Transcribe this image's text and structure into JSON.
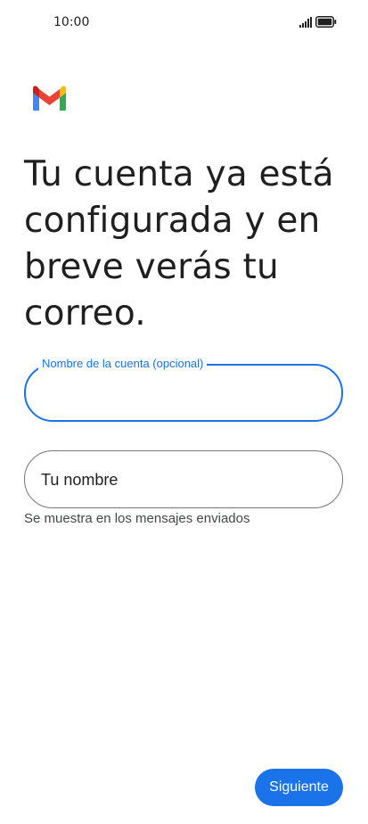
{
  "status_bar": {
    "time": "10:00",
    "icons": [
      "signal-icon",
      "battery-icon"
    ]
  },
  "logo": "gmail-logo",
  "title": "Tu cuenta ya está configurada y en breve verás tu correo.",
  "account_name_field": {
    "label": "Nombre de la cuenta (opcional)",
    "value": ""
  },
  "your_name_field": {
    "label": "Tu nombre",
    "value": "",
    "helper": "Se muestra en los mensajes enviados"
  },
  "next_button": {
    "label": "Siguiente"
  },
  "colors": {
    "accent": "#1a73e8",
    "text": "#1f1f1f",
    "helper_text": "#444746",
    "outline": "#747775",
    "gmail_red": "#ea4335",
    "gmail_blue": "#4285f4",
    "gmail_green": "#34a853",
    "gmail_yellow": "#fbbc04",
    "gmail_dark_red": "#c5221f"
  }
}
